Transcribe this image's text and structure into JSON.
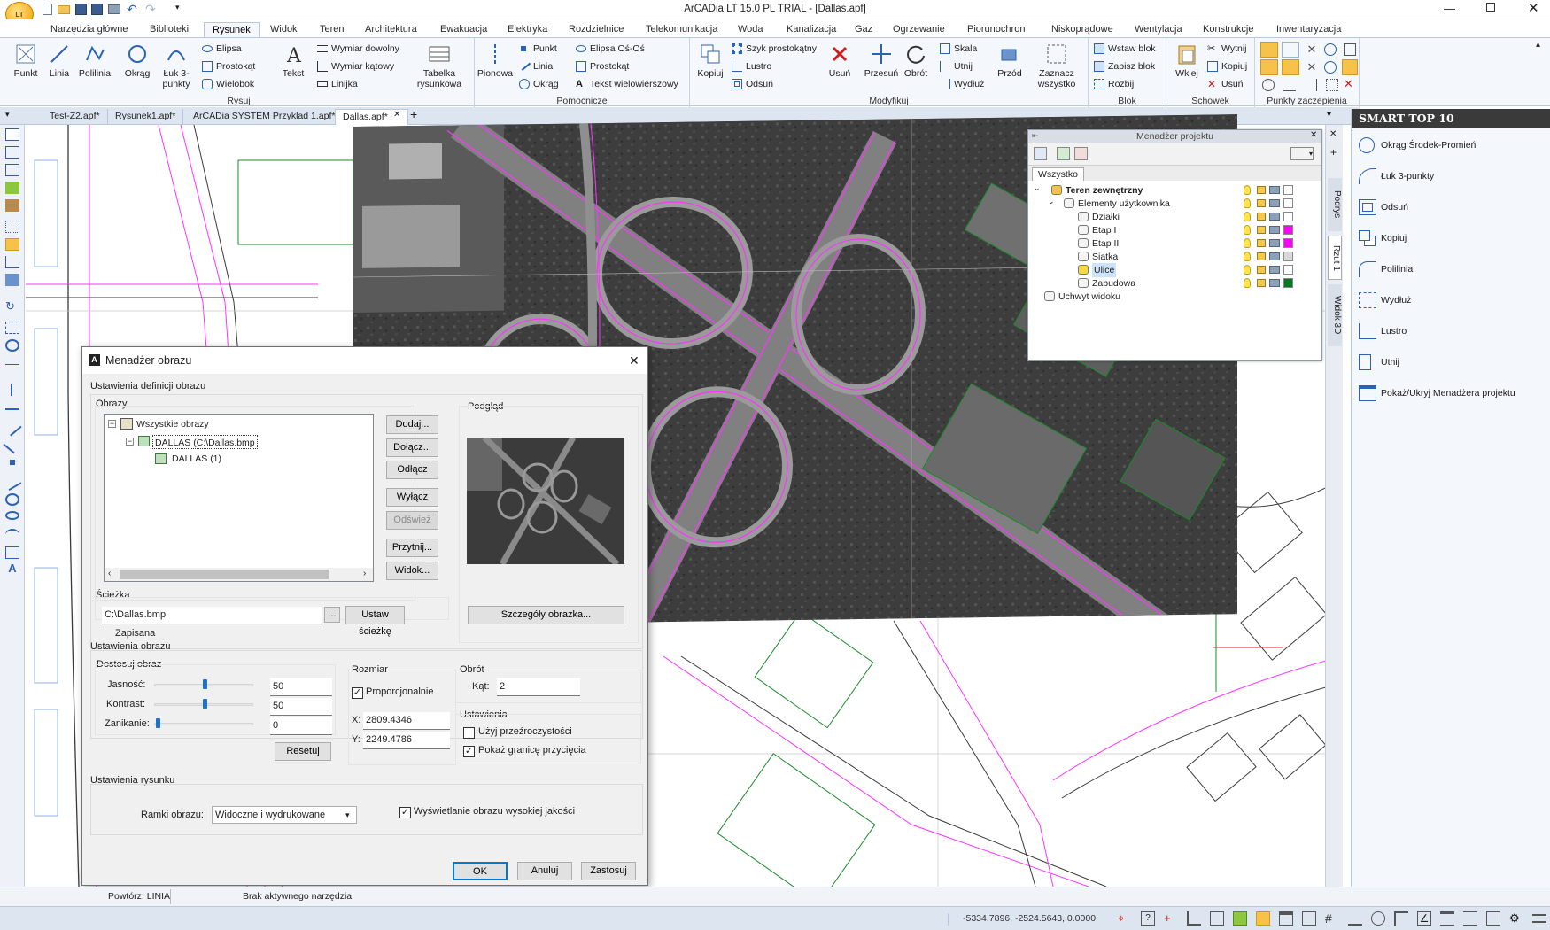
{
  "window": {
    "title": "ArCADia LT 15.0 PL TRIAL - [Dallas.apf]"
  },
  "ribbon_tabs": [
    "Narzędzia główne",
    "Biblioteki",
    "Rysunek",
    "Widok",
    "Teren",
    "Architektura",
    "Ewakuacja",
    "Elektryka",
    "Rozdzielnice",
    "Telekomunikacja",
    "Woda",
    "Kanalizacja",
    "Gaz",
    "Ogrzewanie",
    "Piorunochron",
    "Niskoprądowe",
    "Wentylacja",
    "Konstrukcje",
    "Inwentaryzacja"
  ],
  "ribbon": {
    "rysuj": {
      "label": "Rysuj",
      "punkt": "Punkt",
      "linia": "Linia",
      "polilinia": "Polilinia",
      "okrag": "Okrąg",
      "luk": "Łuk 3-punkty",
      "elipsa": "Elipsa",
      "prostokat": "Prostokąt",
      "wielobok": "Wielobok",
      "tekst": "Tekst",
      "wymiar_dowolny": "Wymiar dowolny",
      "wymiar_katowy": "Wymiar kątowy",
      "linijka": "Linijka",
      "tabelka": "Tabelka rysunkowa"
    },
    "pomocnicze": {
      "label": "Pomocnicze",
      "pionowa": "Pionowa",
      "punkt": "Punkt",
      "linia": "Linia",
      "okrag": "Okrąg",
      "elipsa": "Elipsa Oś-Oś",
      "prostokat": "Prostokąt",
      "tekst": "Tekst wielowierszowy"
    },
    "modyfikuj": {
      "label": "Modyfikuj",
      "kopiuj": "Kopiuj",
      "szyk": "Szyk prostokątny",
      "lustro": "Lustro",
      "odsun": "Odsuń",
      "usun": "Usuń",
      "przesun": "Przesuń",
      "obrot": "Obrót",
      "skala": "Skala",
      "utnij": "Utnij",
      "wydluz": "Wydłuż",
      "przod": "Przód",
      "zaznacz": "Zaznacz wszystko"
    },
    "blok": {
      "label": "Blok",
      "wstaw": "Wstaw blok",
      "zapisz": "Zapisz blok",
      "rozbij": "Rozbij"
    },
    "schowek": {
      "label": "Schowek",
      "wklej": "Wklej",
      "wytnij": "Wytnij",
      "kopiuj": "Kopiuj",
      "usun": "Usuń"
    },
    "punkty": {
      "label": "Punkty zaczepienia"
    }
  },
  "doc_tabs": [
    "Test-Z2.apf*",
    "Rysunek1.apf*",
    "ArCADia SYSTEM Przyklad 1.apf*",
    "Dallas.apf*"
  ],
  "smart": {
    "title": "SMART TOP 10",
    "items": [
      "Okrąg Środek-Promień",
      "Łuk 3-punkty",
      "Odsuń",
      "Kopiuj",
      "Polilinia",
      "Wydłuż",
      "Lustro",
      "Utnij",
      "Pokaż/Ukryj Menadżera projektu"
    ]
  },
  "side_tabs": [
    "Podrys",
    "Rzut 1",
    "Widok 3D"
  ],
  "project_manager": {
    "title": "Menadżer projektu",
    "tab": "Wszystko",
    "tree": [
      {
        "label": "Teren zewnętrzny",
        "level": 0,
        "color": "#ffffff"
      },
      {
        "label": "Elementy użytkownika",
        "level": 1,
        "color": "#ffffff"
      },
      {
        "label": "Działki",
        "level": 2,
        "color": "#ffffff"
      },
      {
        "label": "Etap I",
        "level": 2,
        "color": "#ff00ff"
      },
      {
        "label": "Etap II",
        "level": 2,
        "color": "#ff00ff"
      },
      {
        "label": "Siatka",
        "level": 2,
        "color": "#d8d8d8"
      },
      {
        "label": "Ulice",
        "level": 2,
        "color": "#ffffff"
      },
      {
        "label": "Zabudowa",
        "level": 2,
        "color": "#007a1e"
      },
      {
        "label": "Uchwyt widoku",
        "level": 0,
        "color": ""
      }
    ]
  },
  "dialog": {
    "title": "Menadżer obrazu",
    "section_def": "Ustawienia definicji obrazu",
    "obrazy": "Obrazy",
    "podglad": "Podgląd",
    "tree": [
      "Wszystkie obrazy",
      "DALLAS  (C:\\Dallas.bmp",
      "DALLAS (1)"
    ],
    "buttons": {
      "dodaj": "Dodaj...",
      "dolacz": "Dołącz...",
      "odlacz": "Odłącz",
      "wylacz": "Wyłącz",
      "odswiez": "Odśwież",
      "przytnij": "Przytnij...",
      "widok": "Widok..."
    },
    "sciezka": "Ścieżka",
    "path_value": "C:\\Dallas.bmp",
    "browse": "...",
    "ustaw": "Ustaw ścieżkę",
    "szczegoly": "Szczegóły obrazka...",
    "zapisana": "Zapisana",
    "section_img": "Ustawienia obrazu",
    "dostosuj": "Dostosuj obraz",
    "jasnosc": "Jasność:",
    "jasnosc_val": "50",
    "kontrast": "Kontrast:",
    "kontrast_val": "50",
    "zanikanie": "Zanikanie:",
    "zanikanie_val": "0",
    "resetuj": "Resetuj",
    "rozmiar": "Rozmiar",
    "proporcjonalnie": "Proporcjonalnie",
    "x_label": "X:",
    "x_val": "2809.4346",
    "y_label": "Y:",
    "y_val": "2249.4786",
    "obrot": "Obrót",
    "kat": "Kąt:",
    "kat_val": "2",
    "ustawienia": "Ustawienia",
    "przezroczystosc": "Użyj przeźroczystości",
    "granica": "Pokaż granicę przycięcia",
    "section_rys": "Ustawienia rysunku",
    "ramki": "Ramki obrazu:",
    "ramki_val": "Widoczne i wydrukowane",
    "jakosc": "Wyświetlanie obrazu wysokiej jakości",
    "ok": "OK",
    "anuluj": "Anuluj",
    "zastosuj": "Zastosuj",
    "checked": {
      "proporcjonalnie": true,
      "przezroczystosc": false,
      "granica": true,
      "jakosc": true
    },
    "sliders": {
      "jasnosc": 0.5,
      "kontrast": 0.5,
      "zanikanie": 0.0
    }
  },
  "status": {
    "repeat": "Powtórz: LINIA",
    "tool": "Brak aktywnego narzędzia",
    "coords": "-5334.7896, -2524.5643, 0.0000"
  },
  "colors": {
    "accent": "#1e73c8",
    "layer_magenta": "#ff00ff",
    "layer_green": "#1a8a2a",
    "dialog_bg": "#f0f0f0"
  }
}
